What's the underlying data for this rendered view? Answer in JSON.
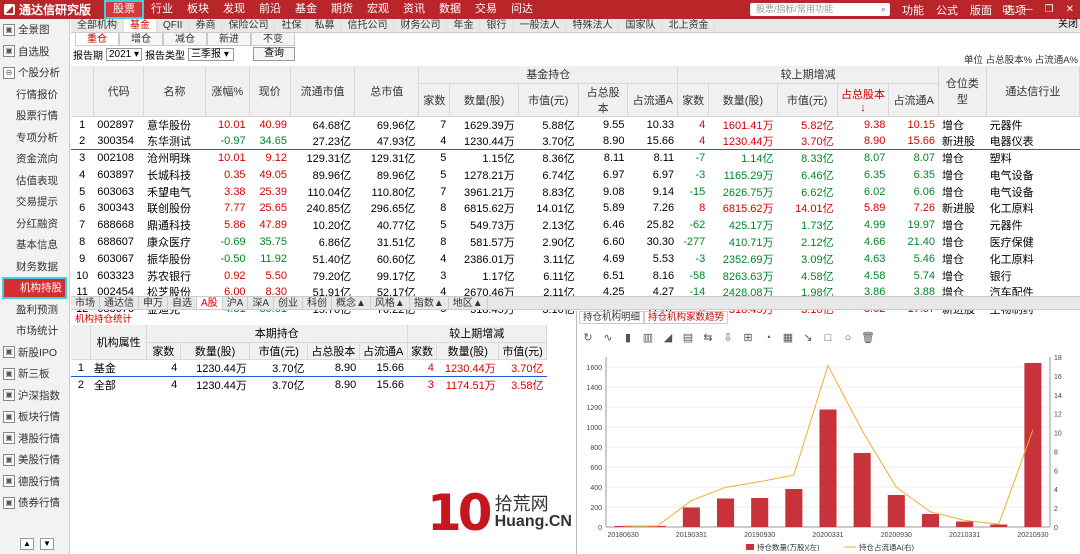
{
  "app": {
    "title": "通达信研究版",
    "logo_glyph": "◢"
  },
  "nav": [
    "股票",
    "行业",
    "板块",
    "发现",
    "前沿",
    "基金",
    "期货",
    "宏观",
    "资讯",
    "数据",
    "交易",
    "问达"
  ],
  "search": {
    "placeholder": "股票/指标/常用功能",
    "icon": "search-icon"
  },
  "right_menu": [
    "功能",
    "公式",
    "版面",
    "选项"
  ],
  "window_buttons": [
    "⊡",
    "—",
    "❐",
    "✕"
  ],
  "sidebar": [
    {
      "label": "全景图",
      "level": 1,
      "icon": "▣"
    },
    {
      "label": "自选股",
      "level": 1,
      "icon": "▣"
    },
    {
      "label": "个股分析",
      "level": 1,
      "icon": "⊖"
    },
    {
      "label": "行情报价",
      "level": 2
    },
    {
      "label": "股票行情",
      "level": 2
    },
    {
      "label": "专项分析",
      "level": 2
    },
    {
      "label": "资金流向",
      "level": 2
    },
    {
      "label": "估值表现",
      "level": 2
    },
    {
      "label": "交易提示",
      "level": 2
    },
    {
      "label": "分红融资",
      "level": 2
    },
    {
      "label": "基本信息",
      "level": 2
    },
    {
      "label": "财务数据",
      "level": 2
    },
    {
      "label": "机构持股",
      "level": 2,
      "active": true
    },
    {
      "label": "盈利预测",
      "level": 2
    },
    {
      "label": "市场统计",
      "level": 2
    },
    {
      "label": "新股IPO",
      "level": 1,
      "icon": "▣"
    },
    {
      "label": "新三板",
      "level": 1,
      "icon": "▣"
    },
    {
      "label": "沪深指数",
      "level": 1,
      "icon": "▣"
    },
    {
      "label": "板块行情",
      "level": 1,
      "icon": "▣"
    },
    {
      "label": "港股行情",
      "level": 1,
      "icon": "▣"
    },
    {
      "label": "美股行情",
      "level": 1,
      "icon": "▣"
    },
    {
      "label": "德股行情",
      "level": 1,
      "icon": "▣"
    },
    {
      "label": "债券行情",
      "level": 1,
      "icon": "▣"
    }
  ],
  "sidebar_scroll": [
    "▲",
    "▼"
  ],
  "tabs1": [
    "全部机构",
    "基金",
    "QFII",
    "券商",
    "保险公司",
    "社保",
    "私募",
    "信托公司",
    "财务公司",
    "年金",
    "银行",
    "一般法人",
    "特殊法人",
    "国家队",
    "北上资金"
  ],
  "tabs1_active": 1,
  "close_label": "关闭",
  "tabs2": [
    "重仓",
    "增仓",
    "减仓",
    "新进",
    "不变"
  ],
  "filter": {
    "period_label": "报告期",
    "year": "2021",
    "type_label": "报告类型",
    "type_value": "三季报",
    "query": "查询"
  },
  "unit_text": "单位 占总股本% 占流通A%",
  "main_table": {
    "group_headers": [
      "基金持仓",
      "较上期增减"
    ],
    "headers": [
      "",
      "代码",
      "名称",
      "涨幅%",
      "现价",
      "流通市值",
      "总市值",
      "家数",
      "数量(股)",
      "市值(元)",
      "占总股本",
      "占流通A",
      "家数",
      "数量(股)",
      "市值(元)",
      "占总股本↓",
      "占流通A",
      "仓位类型",
      "通达信行业"
    ],
    "rows": [
      [
        "1",
        "002897",
        "意华股份",
        "10.01",
        "40.99",
        "64.68亿",
        "69.96亿",
        "7",
        "1629.39万",
        "5.88亿",
        "9.55",
        "10.33",
        "4",
        "1601.41万",
        "5.82亿",
        "9.38",
        "10.15",
        "增仓",
        "元器件"
      ],
      [
        "2",
        "300354",
        "东华测试",
        "-0.97",
        "34.65",
        "27.23亿",
        "47.93亿",
        "4",
        "1230.44万",
        "3.70亿",
        "8.90",
        "15.66",
        "4",
        "1230.44万",
        "3.70亿",
        "8.90",
        "15.66",
        "新进股",
        "电器仪表"
      ],
      [
        "3",
        "002108",
        "沧州明珠",
        "10.01",
        "9.12",
        "129.31亿",
        "129.31亿",
        "5",
        "1.15亿",
        "8.36亿",
        "8.11",
        "8.11",
        "-7",
        "1.14亿",
        "8.33亿",
        "8.07",
        "8.07",
        "增仓",
        "塑料"
      ],
      [
        "4",
        "603897",
        "长城科技",
        "0.35",
        "49.05",
        "89.96亿",
        "89.96亿",
        "5",
        "1278.21万",
        "6.74亿",
        "6.97",
        "6.97",
        "-3",
        "1165.29万",
        "6.46亿",
        "6.35",
        "6.35",
        "增仓",
        "电气设备"
      ],
      [
        "5",
        "603063",
        "禾望电气",
        "3.38",
        "25.39",
        "110.04亿",
        "110.80亿",
        "7",
        "3961.21万",
        "8.83亿",
        "9.08",
        "9.14",
        "-15",
        "2626.75万",
        "6.62亿",
        "6.02",
        "6.06",
        "增仓",
        "电气设备"
      ],
      [
        "6",
        "300343",
        "联创股份",
        "7.77",
        "25.65",
        "240.85亿",
        "296.65亿",
        "8",
        "6815.62万",
        "14.01亿",
        "5.89",
        "7.26",
        "8",
        "6815.62万",
        "14.01亿",
        "5.89",
        "7.26",
        "新进股",
        "化工原料"
      ],
      [
        "7",
        "688668",
        "鼎通科技",
        "5.86",
        "47.89",
        "10.20亿",
        "40.77亿",
        "5",
        "549.73万",
        "2.13亿",
        "6.46",
        "25.82",
        "-62",
        "425.17万",
        "1.73亿",
        "4.99",
        "19.97",
        "增仓",
        "元器件"
      ],
      [
        "8",
        "688607",
        "康众医疗",
        "-0.69",
        "35.75",
        "6.86亿",
        "31.51亿",
        "8",
        "581.57万",
        "2.90亿",
        "6.60",
        "30.30",
        "-277",
        "410.71万",
        "2.12亿",
        "4.66",
        "21.40",
        "增仓",
        "医疗保健"
      ],
      [
        "9",
        "603067",
        "振华股份",
        "-0.50",
        "11.92",
        "51.40亿",
        "60.60亿",
        "4",
        "2386.01万",
        "3.11亿",
        "4.69",
        "5.53",
        "-3",
        "2352.69万",
        "3.09亿",
        "4.63",
        "5.46",
        "增仓",
        "化工原料"
      ],
      [
        "10",
        "603323",
        "苏农银行",
        "0.92",
        "5.50",
        "79.20亿",
        "99.17亿",
        "3",
        "1.17亿",
        "6.11亿",
        "6.51",
        "8.16",
        "-58",
        "8263.63万",
        "4.58亿",
        "4.58",
        "5.74",
        "增仓",
        "银行"
      ],
      [
        "11",
        "002454",
        "松芝股份",
        "6.00",
        "8.30",
        "51.91亿",
        "52.17亿",
        "4",
        "2670.46万",
        "2.11亿",
        "4.25",
        "4.27",
        "-14",
        "2428.08万",
        "1.98亿",
        "3.86",
        "3.88",
        "增仓",
        "汽车配件"
      ],
      [
        "12",
        "688670",
        "金迪克",
        "-4.31",
        "86.61",
        "15.70亿",
        "76.22亿",
        "5",
        "318.45万",
        "3.10亿",
        "3.62",
        "17.57",
        "5",
        "318.45万",
        "3.10亿",
        "3.62",
        "17.57",
        "新进股",
        "生物制药"
      ]
    ]
  },
  "mid_tabs": [
    "市场",
    "通达信",
    "申万",
    "自选",
    "A股",
    "沪A",
    "深A",
    "创业",
    "科创",
    "概念▲",
    "风格▲",
    "指数▲",
    "地区▲"
  ],
  "mid_tabs_active": 4,
  "lower_tab": "机构持仓统计",
  "lower_table": {
    "group_headers": [
      "本期持仓",
      "较上期增减"
    ],
    "headers": [
      "",
      "机构属性",
      "家数",
      "数量(股)",
      "市值(元)",
      "占总股本",
      "占流通A",
      "家数",
      "数量(股)",
      "市值(元)"
    ],
    "rows": [
      [
        "1",
        "基金",
        "4",
        "1230.44万",
        "3.70亿",
        "8.90",
        "15.66",
        "4",
        "1230.44万",
        "3.70亿"
      ],
      [
        "2",
        "全部",
        "4",
        "1230.44万",
        "3.70亿",
        "8.90",
        "15.66",
        "3",
        "1174.51万",
        "3.58亿"
      ]
    ]
  },
  "right_tabs": [
    "持仓机构明细",
    "持仓机构家数趋势"
  ],
  "toolbar_icons": [
    {
      "name": "refresh-icon",
      "glyph": "↻"
    },
    {
      "name": "line-tool-icon",
      "glyph": "∿"
    },
    {
      "name": "bar-tool-icon",
      "glyph": "▮"
    },
    {
      "name": "column-tool-icon",
      "glyph": "▥"
    },
    {
      "name": "area-tool-icon",
      "glyph": "◢"
    },
    {
      "name": "stack-tool-icon",
      "glyph": "▤"
    },
    {
      "name": "swap-icon",
      "glyph": "⇆"
    },
    {
      "name": "download-icon",
      "glyph": "⇩"
    },
    {
      "name": "table-icon",
      "glyph": "⊞"
    },
    {
      "name": "pie-icon",
      "glyph": "◔"
    },
    {
      "name": "grid-icon",
      "glyph": "▦"
    },
    {
      "name": "arrow-icon",
      "glyph": "↘"
    },
    {
      "name": "rect-icon",
      "glyph": "□"
    },
    {
      "name": "circle-icon",
      "glyph": "○"
    },
    {
      "name": "trash-icon",
      "glyph": "🗑"
    }
  ],
  "chart_data": {
    "type": "bar",
    "categories": [
      "20180630",
      "20181231",
      "20190331",
      "20190630",
      "20190930",
      "20191231",
      "20200331",
      "20200630",
      "20200930",
      "20201231",
      "20210331",
      "20210630",
      "20210930"
    ],
    "x_tick_labels": [
      "20180630",
      "",
      "20190331",
      "",
      "20190930",
      "",
      "20200331",
      "",
      "20200930",
      "",
      "20210331",
      "",
      "20210930"
    ],
    "series": [
      {
        "name": "持仓数量(万股)(左)",
        "type": "bar",
        "axis": "left",
        "color": "#c8323a",
        "values": [
          10,
          10,
          195,
          285,
          290,
          380,
          1175,
          740,
          320,
          130,
          55,
          25,
          1640
        ]
      },
      {
        "name": "持仓占流通A(右)",
        "type": "line",
        "axis": "right",
        "color": "#f0b030",
        "values": [
          0.1,
          0.1,
          2.8,
          4.2,
          4.8,
          5.5,
          17.1,
          10.2,
          4.2,
          1.6,
          0.7,
          0.3,
          10.3
        ]
      }
    ],
    "ylim_left": [
      0,
      1700
    ],
    "yticks_left": [
      0,
      200,
      400,
      600,
      800,
      1000,
      1200,
      1400,
      1600
    ],
    "ylim_right": [
      0,
      18
    ],
    "yticks_right": [
      0,
      2,
      4,
      6,
      8,
      10,
      12,
      14,
      16,
      18
    ],
    "legend": "bottom"
  },
  "watermark": {
    "num": "10",
    "zh": "拾荒网",
    "en": "Huang.CN"
  }
}
